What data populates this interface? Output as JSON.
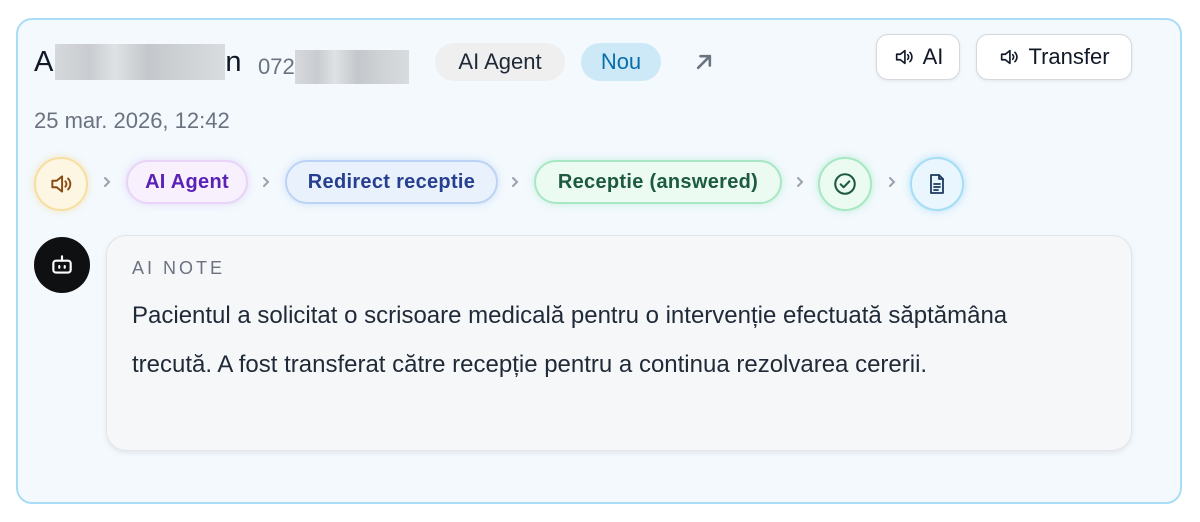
{
  "call": {
    "caller_name_initial": "A",
    "caller_name_tail": "n",
    "phone_prefix": "072",
    "agent_badge": "AI Agent",
    "status_badge": "Nou",
    "timestamp": "25 mar. 2026, 12:42"
  },
  "actions": {
    "ai_label": "AI",
    "transfer_label": "Transfer"
  },
  "flow": {
    "steps": [
      {
        "type": "icon",
        "icon": "speaker-icon"
      },
      {
        "type": "chip",
        "label": "AI Agent"
      },
      {
        "type": "chip",
        "label": "Redirect receptie"
      },
      {
        "type": "chip",
        "label": "Receptie (answered)"
      },
      {
        "type": "icon",
        "icon": "check-circle-icon"
      },
      {
        "type": "icon",
        "icon": "document-icon"
      }
    ]
  },
  "note": {
    "label": "AI NOTE",
    "text": "Pacientul a solicitat o scrisoare medicală pentru o intervenție efectuată săptămâna trecută. A fost transferat către recepție pentru a continua rezolvarea cererii."
  },
  "colors": {
    "card_border": "#a9dcf5",
    "card_bg": "#f3f9fd",
    "status_bg": "#cde9f8",
    "status_text": "#0b6ea8"
  }
}
